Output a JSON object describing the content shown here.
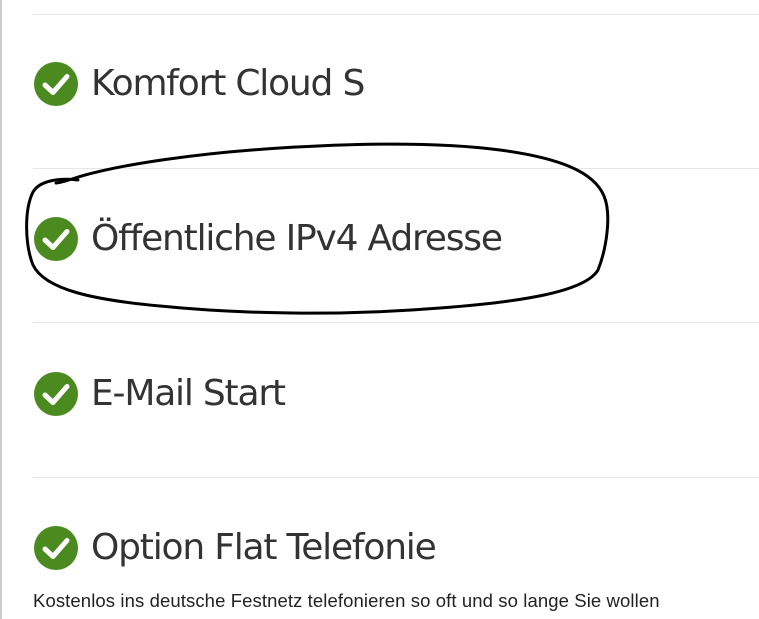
{
  "features": [
    {
      "title": "Komfort Cloud S",
      "icon": "check-circle-icon"
    },
    {
      "title": "Öffentliche IPv4 Adresse",
      "icon": "check-circle-icon"
    },
    {
      "title": "E-Mail Start",
      "icon": "check-circle-icon"
    },
    {
      "title": "Option Flat Telefonie",
      "icon": "check-circle-icon"
    }
  ],
  "description": "Kostenlos ins deutsche Festnetz telefonieren so oft und so lange Sie wollen",
  "colors": {
    "check": "#4a8a1e",
    "text": "#333333",
    "divider": "#e6e6e6",
    "annotation": "#000000"
  }
}
